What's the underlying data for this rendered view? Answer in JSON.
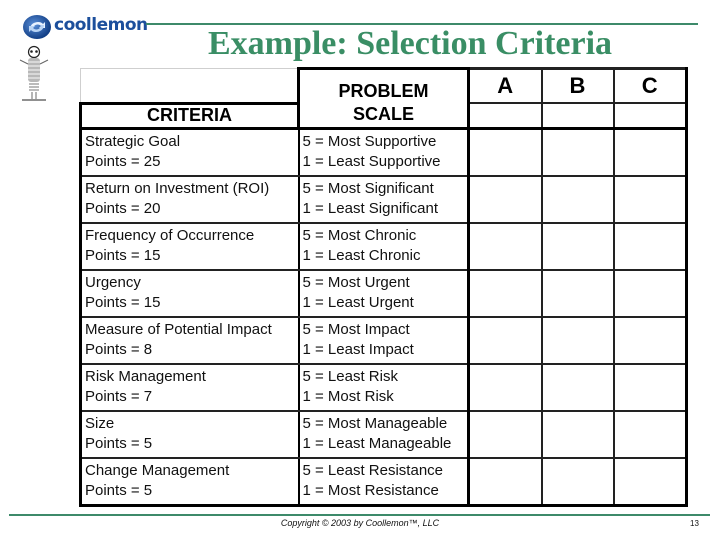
{
  "logo": {
    "text": "coollemon",
    "icon": "swirl-logo-icon",
    "mascot": "coil-mascot-icon"
  },
  "title": "Example: Selection Criteria",
  "table": {
    "header": {
      "problem": "PROBLEM",
      "criteria": "CRITERIA",
      "scale": "SCALE",
      "candidates": [
        "A",
        "B",
        "C"
      ]
    },
    "rows": [
      {
        "criterion": "Strategic Goal",
        "points": "Points = 25",
        "scale_high": "5 = Most Supportive",
        "scale_low": "1 = Least Supportive",
        "scores": [
          "",
          "",
          ""
        ]
      },
      {
        "criterion": "Return on Investment (ROI)",
        "points": "Points = 20",
        "scale_high": "5 = Most Significant",
        "scale_low": "1 = Least Significant",
        "scores": [
          "",
          "",
          ""
        ]
      },
      {
        "criterion": "Frequency of Occurrence",
        "points": "Points = 15",
        "scale_high": "5 = Most Chronic",
        "scale_low": "1 = Least Chronic",
        "scores": [
          "",
          "",
          ""
        ]
      },
      {
        "criterion": "Urgency",
        "points": "Points = 15",
        "scale_high": "5 = Most Urgent",
        "scale_low": "1 = Least Urgent",
        "scores": [
          "",
          "",
          ""
        ]
      },
      {
        "criterion": "Measure of Potential Impact",
        "points": "Points = 8",
        "scale_high": "5 = Most Impact",
        "scale_low": "1 = Least Impact",
        "scores": [
          "",
          "",
          ""
        ]
      },
      {
        "criterion": "Risk Management",
        "points": "Points = 7",
        "scale_high": "5 = Least Risk",
        "scale_low": "1 = Most Risk",
        "scores": [
          "",
          "",
          ""
        ]
      },
      {
        "criterion": "Size",
        "points": "Points = 5",
        "scale_high": "5 = Most Manageable",
        "scale_low": "1 = Least Manageable",
        "scores": [
          "",
          "",
          ""
        ]
      },
      {
        "criterion": "Change Management",
        "points": "Points = 5",
        "scale_high": "5 = Least Resistance",
        "scale_low": "1 = Most Resistance",
        "scores": [
          "",
          "",
          ""
        ]
      }
    ]
  },
  "footer": {
    "copyright": "Copyright © 2003 by Coollemon™, LLC",
    "page_number": "13"
  },
  "colors": {
    "accent_green": "#3a8e65",
    "rule_green": "#3d8a6a",
    "logo_blue": "#1c4f9c"
  }
}
